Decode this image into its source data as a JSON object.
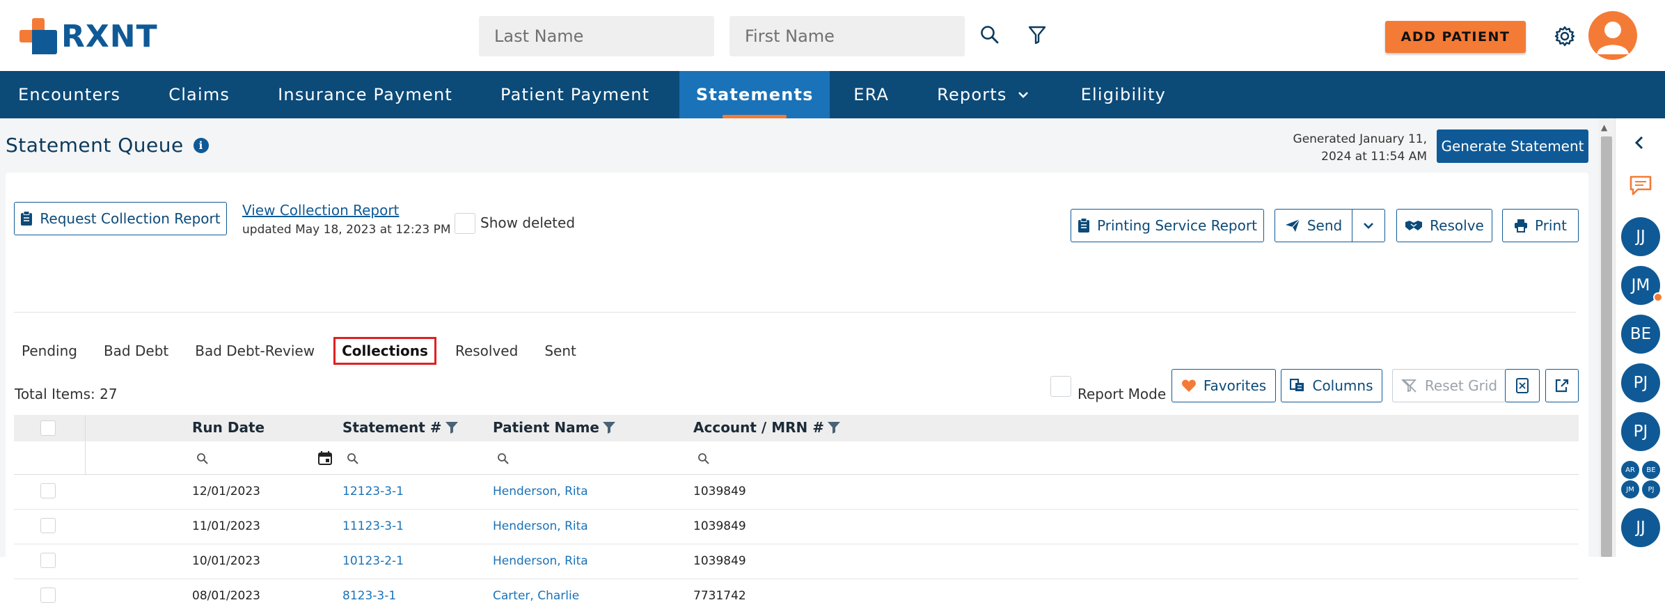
{
  "brand": {
    "name": "RXNT"
  },
  "search": {
    "last_name_placeholder": "Last Name",
    "first_name_placeholder": "First Name"
  },
  "header": {
    "add_patient_label": "ADD PATIENT"
  },
  "nav": {
    "items": [
      {
        "label": "Encounters"
      },
      {
        "label": "Claims"
      },
      {
        "label": "Insurance Payment"
      },
      {
        "label": "Patient Payment"
      },
      {
        "label": "Statements"
      },
      {
        "label": "ERA"
      },
      {
        "label": "Reports"
      },
      {
        "label": "Eligibility"
      }
    ],
    "active": "Statements"
  },
  "page": {
    "title": "Statement Queue",
    "generated_line1": "Generated January 11,",
    "generated_line2": "2024 at 11:54 AM",
    "generate_button": "Generate Statement"
  },
  "toolbar": {
    "request_collection_report": "Request Collection Report",
    "view_collection_report": "View Collection Report",
    "updated_text": "updated May 18, 2023 at 12:23 PM",
    "show_deleted": "Show deleted",
    "printing_service_report": "Printing Service Report",
    "send": "Send",
    "resolve": "Resolve",
    "print": "Print"
  },
  "tabs": [
    {
      "label": "Pending"
    },
    {
      "label": "Bad Debt"
    },
    {
      "label": "Bad Debt-Review"
    },
    {
      "label": "Collections"
    },
    {
      "label": "Resolved"
    },
    {
      "label": "Sent"
    }
  ],
  "active_tab": "Collections",
  "grid_toolbar": {
    "total_items": "Total Items: 27",
    "report_mode": "Report Mode",
    "favorites": "Favorites",
    "columns": "Columns",
    "reset_grid": "Reset Grid"
  },
  "grid": {
    "columns": [
      "Run Date",
      "Statement #",
      "Patient Name",
      "Account / MRN #"
    ],
    "rows": [
      {
        "run_date": "12/01/2023",
        "statement": "12123-3-1",
        "patient": "Henderson, Rita",
        "account": "1039849"
      },
      {
        "run_date": "11/01/2023",
        "statement": "11123-3-1",
        "patient": "Henderson, Rita",
        "account": "1039849"
      },
      {
        "run_date": "10/01/2023",
        "statement": "10123-2-1",
        "patient": "Henderson, Rita",
        "account": "1039849"
      },
      {
        "run_date": "08/01/2023",
        "statement": "8123-3-1",
        "patient": "Carter, Charlie",
        "account": "7731742"
      }
    ]
  },
  "rail": {
    "avatars": [
      "JJ",
      "JM",
      "BE",
      "PJ",
      "PJ"
    ],
    "group": [
      "AR",
      "BE",
      "JM",
      "PJ"
    ],
    "last": "JJ"
  },
  "colors": {
    "brand_orange": "#f47b36",
    "brand_blue": "#0f5a96",
    "nav_bg": "#0c4a78",
    "active_tab_border": "#e02020"
  }
}
